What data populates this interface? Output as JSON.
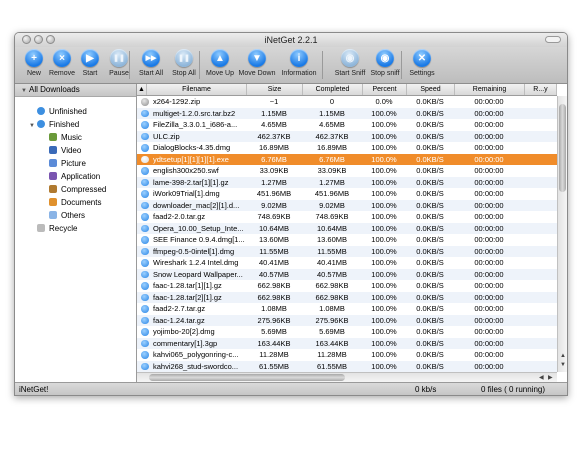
{
  "window": {
    "title": "iNetGet 2.2.1"
  },
  "toolbar": [
    {
      "key": "new",
      "label": "New",
      "glyph": "+",
      "style": "blue"
    },
    {
      "key": "remove",
      "label": "Remove",
      "glyph": "×",
      "style": "blue"
    },
    {
      "key": "start",
      "label": "Start",
      "glyph": "▶",
      "style": "blue"
    },
    {
      "key": "pause",
      "label": "Pause",
      "glyph": "❚❚",
      "style": "faded"
    },
    {
      "key": "start-all",
      "label": "Start All",
      "glyph": "▶▶",
      "style": "blue"
    },
    {
      "key": "stop-all",
      "label": "Stop All",
      "glyph": "❚❚",
      "style": "faded"
    },
    {
      "key": "move-up",
      "label": "Move Up",
      "glyph": "▲",
      "style": "blue"
    },
    {
      "key": "move-down",
      "label": "Move Down",
      "glyph": "▼",
      "style": "blue"
    },
    {
      "key": "information",
      "label": "Information",
      "glyph": "i",
      "style": "blue"
    },
    {
      "key": "start-sniff",
      "label": "Start Sniff",
      "glyph": "◉",
      "style": "faded"
    },
    {
      "key": "stop-sniff",
      "label": "Stop sniff",
      "glyph": "◉",
      "style": "blue"
    },
    {
      "key": "settings",
      "label": "Settings",
      "glyph": "✕",
      "style": "blue"
    }
  ],
  "sidebar": {
    "items": [
      {
        "label": "All Downloads",
        "level": 0,
        "icon": "triangle-down-icon"
      },
      {
        "label": "Unfinished",
        "level": 1,
        "icon": "globe-icon"
      },
      {
        "label": "Finished",
        "level": 1,
        "icon": "check-icon"
      },
      {
        "label": "Music",
        "level": 2,
        "icon": "music-icon"
      },
      {
        "label": "Video",
        "level": 2,
        "icon": "video-icon"
      },
      {
        "label": "Picture",
        "level": 2,
        "icon": "picture-icon"
      },
      {
        "label": "Application",
        "level": 2,
        "icon": "application-icon"
      },
      {
        "label": "Compressed",
        "level": 2,
        "icon": "compressed-icon"
      },
      {
        "label": "Documents",
        "level": 2,
        "icon": "documents-icon"
      },
      {
        "label": "Others",
        "level": 2,
        "icon": "others-icon"
      },
      {
        "label": "Recycle",
        "level": 1,
        "icon": "recycle-icon"
      }
    ]
  },
  "columns": [
    "Filename",
    "Size",
    "Completed",
    "Percent",
    "Speed",
    "Remaining",
    "R...y"
  ],
  "rows": [
    {
      "name": "x264-1292.zip",
      "size": "~1",
      "done": "0",
      "pct": "0.0%",
      "speed": "0.0KB/S",
      "rem": "00:00:00",
      "state": "paused"
    },
    {
      "name": "multiget-1.2.0.src.tar.bz2",
      "size": "1.15MB",
      "done": "1.15MB",
      "pct": "100.0%",
      "speed": "0.0KB/S",
      "rem": "00:00:00",
      "state": "done"
    },
    {
      "name": "FileZilla_3.3.0.1_i686-a...",
      "size": "4.65MB",
      "done": "4.65MB",
      "pct": "100.0%",
      "speed": "0.0KB/S",
      "rem": "00:00:00",
      "state": "done"
    },
    {
      "name": "ULC.zip",
      "size": "462.37KB",
      "done": "462.37KB",
      "pct": "100.0%",
      "speed": "0.0KB/S",
      "rem": "00:00:00",
      "state": "done"
    },
    {
      "name": "DialogBlocks-4.35.dmg",
      "size": "16.89MB",
      "done": "16.89MB",
      "pct": "100.0%",
      "speed": "0.0KB/S",
      "rem": "00:00:00",
      "state": "done"
    },
    {
      "name": "ydtsetup[1][1][1][1].exe",
      "size": "6.76MB",
      "done": "6.76MB",
      "pct": "100.0%",
      "speed": "0.0KB/S",
      "rem": "00:00:00",
      "state": "selected"
    },
    {
      "name": "english300x250.swf",
      "size": "33.09KB",
      "done": "33.09KB",
      "pct": "100.0%",
      "speed": "0.0KB/S",
      "rem": "00:00:00",
      "state": "done"
    },
    {
      "name": "lame-398-2.tar[1][1].gz",
      "size": "1.27MB",
      "done": "1.27MB",
      "pct": "100.0%",
      "speed": "0.0KB/S",
      "rem": "00:00:00",
      "state": "done"
    },
    {
      "name": "iWork09Trial[1].dmg",
      "size": "451.96MB",
      "done": "451.96MB",
      "pct": "100.0%",
      "speed": "0.0KB/S",
      "rem": "00:00:00",
      "state": "done"
    },
    {
      "name": "downloader_mac[2][1].d...",
      "size": "9.02MB",
      "done": "9.02MB",
      "pct": "100.0%",
      "speed": "0.0KB/S",
      "rem": "00:00:00",
      "state": "done"
    },
    {
      "name": "faad2-2.0.tar.gz",
      "size": "748.69KB",
      "done": "748.69KB",
      "pct": "100.0%",
      "speed": "0.0KB/S",
      "rem": "00:00:00",
      "state": "done"
    },
    {
      "name": "Opera_10.00_Setup_Inte...",
      "size": "10.64MB",
      "done": "10.64MB",
      "pct": "100.0%",
      "speed": "0.0KB/S",
      "rem": "00:00:00",
      "state": "done"
    },
    {
      "name": "SEE Finance 0.9.4.dmg[1...",
      "size": "13.60MB",
      "done": "13.60MB",
      "pct": "100.0%",
      "speed": "0.0KB/S",
      "rem": "00:00:00",
      "state": "done"
    },
    {
      "name": "ffmpeg-0.5-0intel[1].dmg",
      "size": "11.55MB",
      "done": "11.55MB",
      "pct": "100.0%",
      "speed": "0.0KB/S",
      "rem": "00:00:00",
      "state": "done"
    },
    {
      "name": "Wireshark 1.2.4 Intel.dmg",
      "size": "40.41MB",
      "done": "40.41MB",
      "pct": "100.0%",
      "speed": "0.0KB/S",
      "rem": "00:00:00",
      "state": "done"
    },
    {
      "name": "Snow Leopard Wallpaper...",
      "size": "40.57MB",
      "done": "40.57MB",
      "pct": "100.0%",
      "speed": "0.0KB/S",
      "rem": "00:00:00",
      "state": "done"
    },
    {
      "name": "faac-1.28.tar[1][1].gz",
      "size": "662.98KB",
      "done": "662.98KB",
      "pct": "100.0%",
      "speed": "0.0KB/S",
      "rem": "00:00:00",
      "state": "done"
    },
    {
      "name": "faac-1.28.tar[2][1].gz",
      "size": "662.98KB",
      "done": "662.98KB",
      "pct": "100.0%",
      "speed": "0.0KB/S",
      "rem": "00:00:00",
      "state": "done"
    },
    {
      "name": "faad2-2.7.tar.gz",
      "size": "1.08MB",
      "done": "1.08MB",
      "pct": "100.0%",
      "speed": "0.0KB/S",
      "rem": "00:00:00",
      "state": "done"
    },
    {
      "name": "faac-1.24.tar.gz",
      "size": "275.96KB",
      "done": "275.96KB",
      "pct": "100.0%",
      "speed": "0.0KB/S",
      "rem": "00:00:00",
      "state": "done"
    },
    {
      "name": "yojimbo-20[2].dmg",
      "size": "5.69MB",
      "done": "5.69MB",
      "pct": "100.0%",
      "speed": "0.0KB/S",
      "rem": "00:00:00",
      "state": "done"
    },
    {
      "name": "commentary[1].3gp",
      "size": "163.44KB",
      "done": "163.44KB",
      "pct": "100.0%",
      "speed": "0.0KB/S",
      "rem": "00:00:00",
      "state": "done"
    },
    {
      "name": "kahvi065_polygonring-c...",
      "size": "11.28MB",
      "done": "11.28MB",
      "pct": "100.0%",
      "speed": "0.0KB/S",
      "rem": "00:00:00",
      "state": "done"
    },
    {
      "name": "kahvi268_stud-swordco...",
      "size": "61.55MB",
      "done": "61.55MB",
      "pct": "100.0%",
      "speed": "0.0KB/S",
      "rem": "00:00:00",
      "state": "done"
    }
  ],
  "status": {
    "app": "iNetGet!",
    "speed": "0 kb/s",
    "files": "0 files ( 0 running)"
  }
}
